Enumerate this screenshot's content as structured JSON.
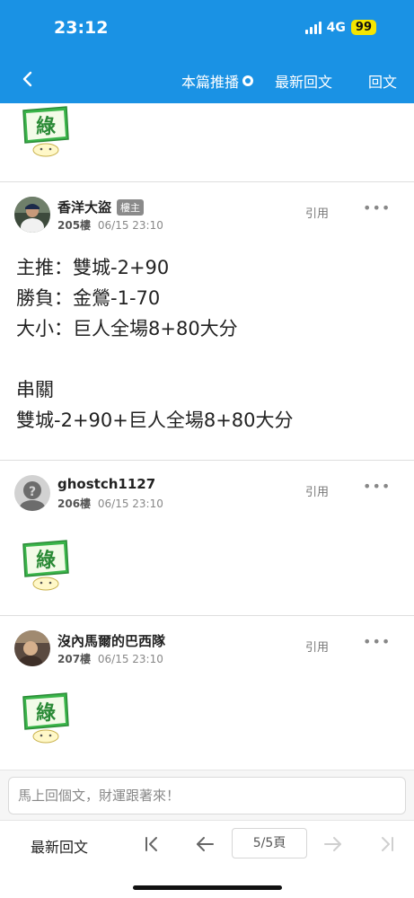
{
  "status_bar": {
    "time": "23:12",
    "network": "4G",
    "battery": "99"
  },
  "header": {
    "push_label": "本篇推播",
    "latest_label": "最新回文",
    "reply_label": "回文"
  },
  "sticker": {
    "char": "綠"
  },
  "posts": [
    {
      "username": "香洋大盜",
      "badge": "樓主",
      "floor": "205樓",
      "time": "06/15 23:10",
      "quote": "引用",
      "more": "•••",
      "content": "主推：雙城-2+90\n勝負：金鶯-1-70\n大小：巨人全場8+80大分\n\n串關\n雙城-2+90+巨人全場8+80大分"
    },
    {
      "username": "ghostch1127",
      "floor": "206樓",
      "time": "06/15 23:10",
      "quote": "引用",
      "more": "•••",
      "avatar_char": "?"
    },
    {
      "username": "沒內馬爾的巴西隊",
      "floor": "207樓",
      "time": "06/15 23:10",
      "quote": "引用",
      "more": "•••"
    }
  ],
  "reply_input": {
    "placeholder": "馬上回個文，財運跟著來！"
  },
  "bottom_bar": {
    "latest_label": "最新回文",
    "page_label": "5/5頁"
  },
  "colors": {
    "header_bg": "#1a92e4",
    "battery": "#f5e500",
    "sticker_green": "#3ab54a"
  }
}
